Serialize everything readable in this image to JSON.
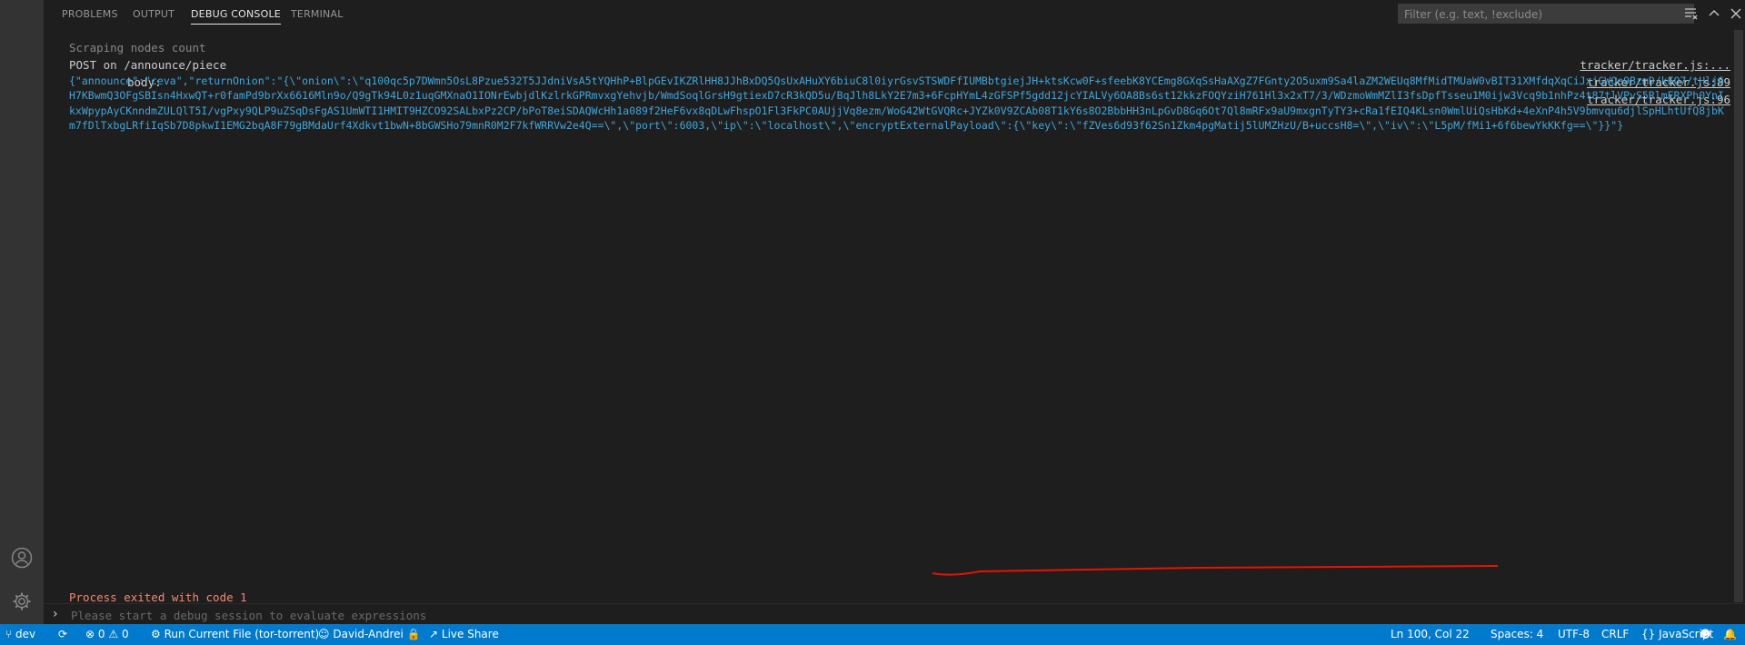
{
  "tabs": [
    "PROBLEMS",
    "OUTPUT",
    "DEBUG CONSOLE",
    "TERMINAL"
  ],
  "filter": {
    "placeholder": "Filter (e.g. text, !exclude)"
  },
  "console": {
    "truncated_line": "Scraping nodes count",
    "truncated_src": "tracker/tracker.js:...",
    "line1": "POST on /announce/piece",
    "line1_src": "tracker/tracker.js:89",
    "line2": "body:",
    "line2_src": "tracker/tracker.js:96",
    "payload": "{\"announce\":\"ceva\",\"returnOnion\":\"{\\\"onion\\\":\\\"q100qc5p7DWmn5OsL8Pzue532T5JJdniVsA5tYQHhP+BlpGEvIKZRlHH8JJhBxDQ5QsUxAHuXY6biuC8l0iyrGsvSTSWDFfIUMBbtgiejJH+ktsKcw0F+sfeebK8YCEmg8GXqSsHaAXgZ7FGnty2O5uxm9Sa4laZM2WEUq8MfMidTMUaW0vBIT31XMfdqXqCiJxjGWQe9BzmD/kEQ7/tHlj6H7KBwmQ3OFgSBIsn4HxwQT+r0famPd9brXx6616Mln9o/Q9gTk94L0z1uqGMXnaO1IONrEwbjdlKzlrkGPRmvxgYehvjb/WmdSoqlGrsH9gtiexD7cR3kQD5u/BqJlh8LkY2E7m3+6FcpHYmL4zGFSPf5gdd12jcYIALVy6OA8Bs6st12kkzFOQYziH761Hl3x2xT7/3/WDzmoWmMZlI3fsDpfTsseu1M0ijw3Vcq9b1nhPz4t87tlVPvS5RlmERXPh0YnIkxWpypAyCKnndmZULQlT5I/vgPxy9QLP9uZSqDsFgAS1UmWTI1HMIT9HZCO92SALbxPz2CP/bPoT8eiSDAQWcHh1a089f2HeF6vx8qDLwFhspO1Fl3FkPC0AUjjVq8ezm/WoG42WtGVQRc+JYZk0V9ZCAb08T1kY6s8O2BbbHH3nLpGvD8Gq6Ot7Ql8mRFx9aU9mxgnTyTY3+cRa1fEIQ4KLsn0WmlUiQsHbKd+4eXnP4h5V9bmvqu6djlSpHLhtUfQ8jbKm7fDlTxbgLRfiIqSb7D8pkwI1EMG2bqA8F79gBMdaUrf4Xdkvt1bwN+8bGWSHo79mnR0M2F7kfWRRVw2e4Q==\\\",\\\"port\\\":6003,\\\"ip\\\":\\\"localhost\\\",\\\"encryptExternalPayload\\\":{\\\"key\\\":\\\"fZVes6d93f62Sn1Zkm4pgMatij5lUMZHzU/B+uccsH8=\\\",\\\"iv\\\":\\\"L5pM/fMi1+6f6bewYkKKfg==\\\"}}\"}",
    "exit": "Process exited with code 1"
  },
  "repl": {
    "placeholder": "Please start a debug session to evaluate expressions"
  },
  "status": {
    "branch": "dev",
    "errors": "0",
    "warnings": "0",
    "run": "Run Current File (tor-torrent)",
    "user": "David-Andrei",
    "live": "Live Share",
    "position": "Ln 100, Col 22",
    "spaces": "Spaces: 4",
    "encoding": "UTF-8",
    "eol": "CRLF",
    "language": "JavaScript"
  },
  "colors": {
    "accent": "#007acc",
    "payload": "#3fa7dd",
    "error": "#f48771",
    "annotation": "#e51400"
  }
}
